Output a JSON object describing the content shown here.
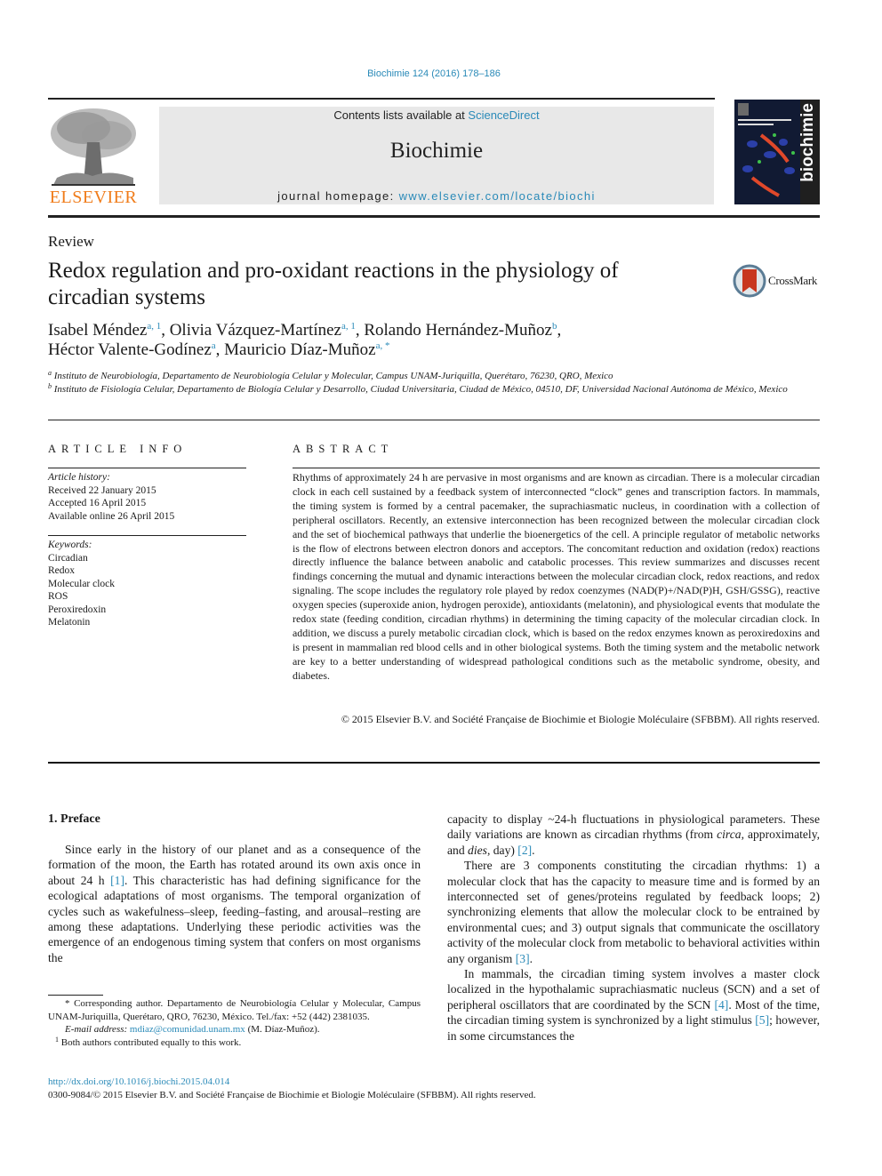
{
  "header": {
    "journal_ref": "Biochimie 124 (2016) 178–186",
    "publisher_logo_text": "ELSEVIER",
    "contents_prefix": "Contents lists available at ",
    "contents_link": "ScienceDirect",
    "journal_name": "Biochimie",
    "homepage_prefix": "journal homepage: ",
    "homepage_link": "www.elsevier.com/locate/biochi",
    "cover_word": "biochimie",
    "colors": {
      "link_blue": "#2a8ab8",
      "elsevier_orange": "#f07c1a",
      "masthead_gray": "#e8e8e8"
    }
  },
  "article": {
    "type": "Review",
    "title": "Redox regulation and pro-oxidant reactions in the physiology of circadian systems",
    "crossmark_label": "CrossMark",
    "authors": [
      {
        "name": "Isabel Méndez",
        "sup": "a, 1",
        "sep": ", "
      },
      {
        "name": "Olivia Vázquez-Martínez",
        "sup": "a, 1",
        "sep": ", "
      },
      {
        "name": "Rolando Hernández-Muñoz",
        "sup": "b",
        "sep": ","
      },
      {
        "name": "Héctor Valente-Godínez",
        "sup": "a",
        "sep": ", "
      },
      {
        "name": "Mauricio Díaz-Muñoz",
        "sup": "a, *",
        "sep": ""
      }
    ],
    "affiliations": [
      {
        "mark": "a",
        "text": "Instituto de Neurobiología, Departamento de Neurobiología Celular y Molecular, Campus UNAM-Juriquilla, Querétaro, 76230, QRO, Mexico"
      },
      {
        "mark": "b",
        "text": "Instituto de Fisiología Celular, Departamento de Biología Celular y Desarrollo, Ciudad Universitaria, Ciudad de México, 04510, DF, Universidad Nacional Autónoma de México, Mexico"
      }
    ]
  },
  "article_info": {
    "heading": "ARTICLE INFO",
    "history_label": "Article history:",
    "history": [
      "Received 22 January 2015",
      "Accepted 16 April 2015",
      "Available online 26 April 2015"
    ],
    "keywords_label": "Keywords:",
    "keywords": [
      "Circadian",
      "Redox",
      "Molecular clock",
      "ROS",
      "Peroxiredoxin",
      "Melatonin"
    ]
  },
  "abstract": {
    "heading": "ABSTRACT",
    "text": "Rhythms of approximately 24 h are pervasive in most organisms and are known as circadian. There is a molecular circadian clock in each cell sustained by a feedback system of interconnected “clock” genes and transcription factors. In mammals, the timing system is formed by a central pacemaker, the suprachiasmatic nucleus, in coordination with a collection of peripheral oscillators. Recently, an extensive interconnection has been recognized between the molecular circadian clock and the set of biochemical pathways that underlie the bioenergetics of the cell. A principle regulator of metabolic networks is the flow of electrons between electron donors and acceptors. The concomitant reduction and oxidation (redox) reactions directly influence the balance between anabolic and catabolic processes. This review summarizes and discusses recent findings concerning the mutual and dynamic interactions between the molecular circadian clock, redox reactions, and redox signaling. The scope includes the regulatory role played by redox coenzymes (NAD(P)+/NAD(P)H, GSH/GSSG), reactive oxygen species (superoxide anion, hydrogen peroxide), antioxidants (melatonin), and physiological events that modulate the redox state (feeding condition, circadian rhythms) in determining the timing capacity of the molecular circadian clock. In addition, we discuss a purely metabolic circadian clock, which is based on the redox enzymes known as peroxiredoxins and is present in mammalian red blood cells and in other biological systems. Both the timing system and the metabolic network are key to a better understanding of widespread pathological conditions such as the metabolic syndrome, obesity, and diabetes.",
    "copyright": "© 2015 Elsevier B.V. and Société Française de Biochimie et Biologie Moléculaire (SFBBM). All rights reserved."
  },
  "body": {
    "section_heading": "1.  Preface",
    "col1": {
      "p1_a": "Since early in the history of our planet and as a consequence of the formation of the moon, the Earth has rotated around its own axis once in about 24 h ",
      "cite1": "[1]",
      "p1_b": ". This characteristic has had defining significance for the ecological adaptations of most organisms. The temporal organization of cycles such as wakefulness–sleep, feeding–fasting, and arousal–resting are among these adaptations. Underlying these periodic activities was the emergence of an endogenous timing system that confers on most organisms the"
    },
    "col2": {
      "p1_a": "capacity to display ~24-h fluctuations in physiological parameters. These daily variations are known as circadian rhythms (from ",
      "p1_circa": "circa",
      "p1_b": ", approximately, and ",
      "p1_dies": "dies",
      "p1_c": ", day) ",
      "cite2": "[2]",
      "p1_d": ".",
      "p2_a": "There are 3 components constituting the circadian rhythms: 1) a molecular clock that has the capacity to measure time and is formed by an interconnected set of genes/proteins regulated by feedback loops; 2) synchronizing elements that allow the molecular clock to be entrained by environmental cues; and 3) output signals that communicate the oscillatory activity of the molecular clock from metabolic to behavioral activities within any organism ",
      "cite3": "[3]",
      "p2_b": ".",
      "p3_a": "In mammals, the circadian timing system involves a master clock localized in the hypothalamic suprachiasmatic nucleus (SCN) and a set of peripheral oscillators that are coordinated by the SCN ",
      "cite4": "[4]",
      "p3_b": ". Most of the time, the circadian timing system is synchronized by a light stimulus ",
      "cite5": "[5]",
      "p3_c": "; however, in some circumstances the"
    },
    "footnotes": {
      "star_mark": "*",
      "corresponding": "Corresponding author. Departamento de Neurobiología Celular y Molecular, Campus UNAM-Juriquilla, Querétaro, QRO, 76230, México. Tel./fax: +52 (442) 2381035.",
      "email_label": "E-mail address: ",
      "email": "mdiaz@comunidad.unam.mx",
      "email_suffix": " (M. Díaz-Muñoz).",
      "one_mark": "1",
      "equal": "Both authors contributed equally to this work."
    }
  },
  "footer": {
    "doi": "http://dx.doi.org/10.1016/j.biochi.2015.04.014",
    "issn": "0300-9084/© 2015 Elsevier B.V. and Société Française de Biochimie et Biologie Moléculaire (SFBBM). All rights reserved."
  }
}
